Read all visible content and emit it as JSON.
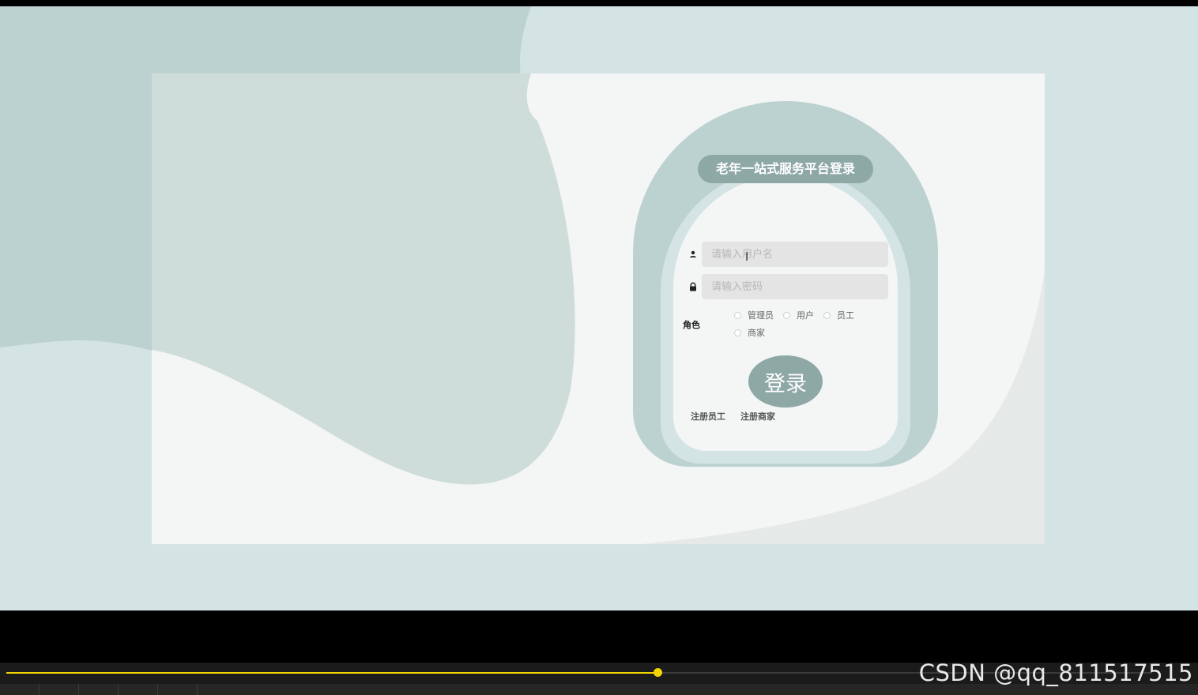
{
  "login": {
    "title": "老年一站式服务平台登录",
    "username_placeholder": "请输入用户名",
    "password_placeholder": "请输入密码",
    "role_label": "角色",
    "roles": [
      "管理员",
      "用户",
      "员工",
      "商家"
    ],
    "submit_label": "登录",
    "register_staff": "注册员工",
    "register_merchant": "注册商家"
  },
  "player": {
    "progress": 0.568
  },
  "watermark": "CSDN @qq_811517515",
  "colors": {
    "accent": "#8ea8a6",
    "card": "#bcd2d0",
    "page_bg": "#d4e3e4",
    "panel": "#f4f5f5",
    "progress": "#f2d400"
  },
  "icons": {
    "username": "user-icon",
    "password": "lock-icon",
    "cursor": "text-cursor-icon"
  }
}
